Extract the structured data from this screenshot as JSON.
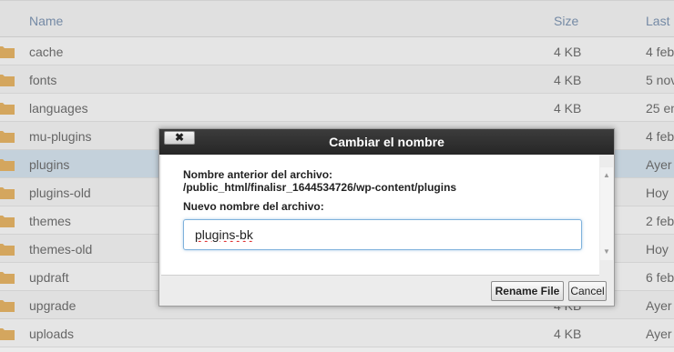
{
  "table": {
    "headers": {
      "name": "Name",
      "size": "Size",
      "last": "Last"
    },
    "rows": [
      {
        "name": "cache",
        "size": "4 KB",
        "last": "4 feb"
      },
      {
        "name": "fonts",
        "size": "4 KB",
        "last": "5 nov"
      },
      {
        "name": "languages",
        "size": "4 KB",
        "last": "25 en"
      },
      {
        "name": "mu-plugins",
        "size": "",
        "last": "4 feb"
      },
      {
        "name": "plugins",
        "size": "",
        "last": "Ayer"
      },
      {
        "name": "plugins-old",
        "size": "",
        "last": "Hoy"
      },
      {
        "name": "themes",
        "size": "",
        "last": "2 feb"
      },
      {
        "name": "themes-old",
        "size": "",
        "last": "Hoy"
      },
      {
        "name": "updraft",
        "size": "",
        "last": "6 feb"
      },
      {
        "name": "upgrade",
        "size": "4 KB",
        "last": "Ayer"
      },
      {
        "name": "uploads",
        "size": "4 KB",
        "last": "Ayer"
      }
    ],
    "selected_row": "plugins",
    "folder_icon_color": "#e6b566"
  },
  "dialog": {
    "title": "Cambiar el nombre",
    "close_label": "✖",
    "old_name_label": "Nombre anterior del archivo:",
    "old_path": "/public_html/finalisr_1644534726/wp-content/plugins",
    "new_name_label": "Nuevo nombre del archivo:",
    "new_name_value": "plugins-bk",
    "rename_button": "Rename File",
    "cancel_button": "Cancel",
    "scroll_up": "▲",
    "scroll_down": "▼"
  },
  "colors": {
    "titlebar": "#2c2c2c",
    "header_text": "#7f96b4",
    "selected_row": "#d5e3ee",
    "input_focus": "#7fb2dc"
  }
}
